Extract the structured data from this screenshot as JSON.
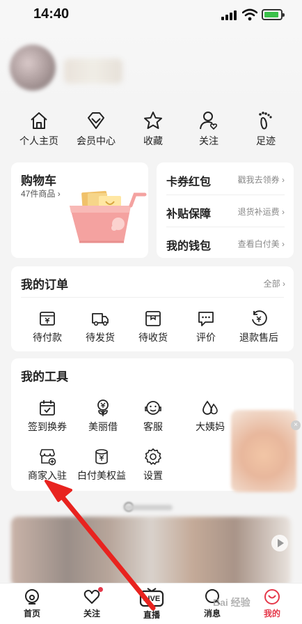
{
  "status": {
    "time": "14:40"
  },
  "quicknav": [
    {
      "label": "个人主页",
      "icon": "home-icon"
    },
    {
      "label": "会员中心",
      "icon": "diamond-icon"
    },
    {
      "label": "收藏",
      "icon": "star-icon"
    },
    {
      "label": "关注",
      "icon": "user-heart-icon"
    },
    {
      "label": "足迹",
      "icon": "footprint-icon"
    }
  ],
  "cart": {
    "title": "购物车",
    "count_text": "47件商品"
  },
  "right_card": [
    {
      "label": "卡券红包",
      "sub": "戳我去领券"
    },
    {
      "label": "补贴保障",
      "sub": "退货补运费"
    },
    {
      "label": "我的钱包",
      "sub": "查看白付美"
    }
  ],
  "orders": {
    "title": "我的订单",
    "more": "全部",
    "items": [
      {
        "label": "待付款",
        "icon": "wallet-icon"
      },
      {
        "label": "待发货",
        "icon": "truck-icon"
      },
      {
        "label": "待收货",
        "icon": "package-icon"
      },
      {
        "label": "评价",
        "icon": "comment-icon"
      },
      {
        "label": "退款售后",
        "icon": "refund-icon"
      }
    ]
  },
  "tools": {
    "title": "我的工具",
    "items": [
      {
        "label": "签到换券",
        "icon": "calendar-check-icon"
      },
      {
        "label": "美丽借",
        "icon": "money-flower-icon"
      },
      {
        "label": "客服",
        "icon": "customer-service-icon"
      },
      {
        "label": "大姨妈",
        "icon": "drops-icon"
      },
      {
        "label": "商家入驻",
        "icon": "shop-plus-icon"
      },
      {
        "label": "白付美权益",
        "icon": "coin-stack-icon"
      },
      {
        "label": "设置",
        "icon": "gear-icon"
      }
    ]
  },
  "tabbar": [
    {
      "label": "首页",
      "icon": "home-tab-icon"
    },
    {
      "label": "关注",
      "icon": "heart-icon"
    },
    {
      "label": "直播",
      "icon": "live-tv-icon",
      "badge": "LIVE"
    },
    {
      "label": "消息",
      "icon": "message-icon"
    },
    {
      "label": "我的",
      "icon": "me-icon"
    }
  ],
  "watermark": "Bai 经验",
  "colors": {
    "accent": "#e5384a",
    "background": "#f4f4f4"
  }
}
